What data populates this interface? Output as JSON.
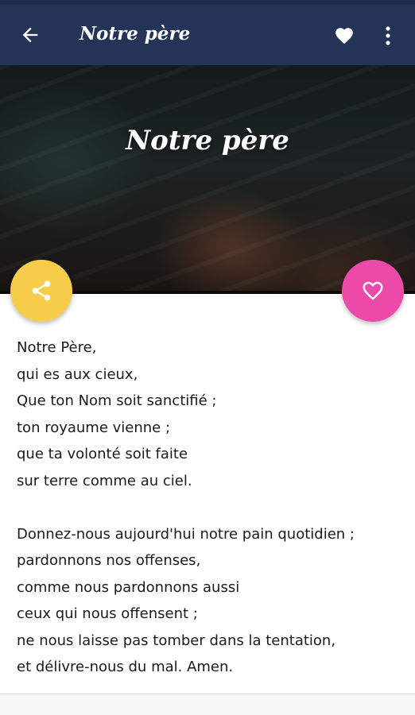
{
  "appbar": {
    "title": "Notre père",
    "back_icon": "arrow-left-icon",
    "favorite_icon": "heart-filled-icon",
    "menu_icon": "more-vertical-icon"
  },
  "hero": {
    "title": "Notre père"
  },
  "actions": {
    "share_icon": "share-icon",
    "like_icon": "heart-outline-icon"
  },
  "prayer": {
    "stanza1": [
      "Notre Père,",
      "qui es aux cieux,",
      "Que ton Nom soit sanctifié ;",
      "ton royaume vienne ;",
      "que ta volonté soit faite",
      "sur terre comme au ciel."
    ],
    "stanza2": [
      "Donnez-nous aujourd'hui notre pain quotidien ;",
      "pardonnons nos offenses,",
      "comme nous pardonnons aussi",
      "ceux qui nous offensent ;",
      "ne nous laisse pas tomber dans la tentation,",
      "et délivre-nous du mal. Amen."
    ]
  },
  "colors": {
    "appbar": "#243459",
    "share_fab": "#f9cd4c",
    "like_fab": "#ec4aa9"
  }
}
